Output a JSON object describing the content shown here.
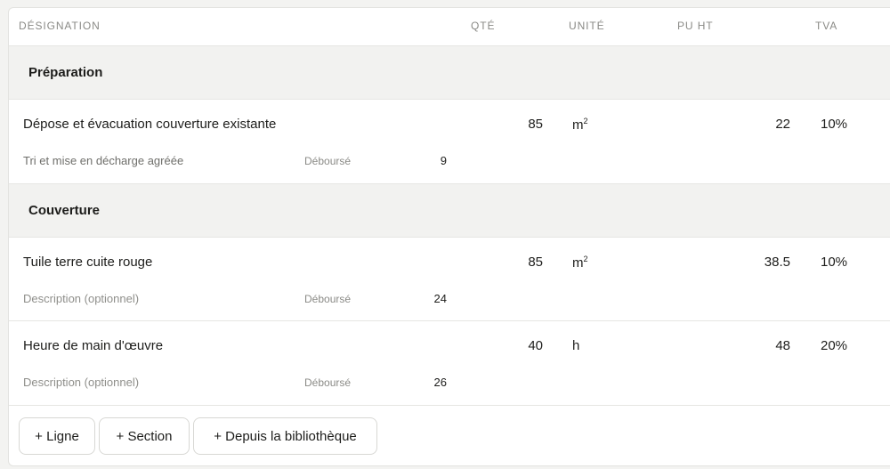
{
  "header": {
    "designation": "DÉSIGNATION",
    "qty": "QTÉ",
    "unit": "UNITÉ",
    "pu_ht": "PU HT",
    "tva": "TVA"
  },
  "sections": [
    {
      "title": "Préparation",
      "lines": [
        {
          "designation": "Dépose et évacuation couverture existante",
          "description": "Tri et mise en décharge agréée",
          "debourse_label": "Déboursé",
          "debourse": "9",
          "qty": "85",
          "unit": "m",
          "unit_sup": "2",
          "pu_ht": "22",
          "tva": "10%"
        }
      ]
    },
    {
      "title": "Couverture",
      "lines": [
        {
          "designation": "Tuile terre cuite rouge",
          "description_placeholder": "Description (optionnel)",
          "debourse_label": "Déboursé",
          "debourse": "24",
          "qty": "85",
          "unit": "m",
          "unit_sup": "2",
          "pu_ht": "38.5",
          "tva": "10%"
        },
        {
          "designation": "Heure de main d'œuvre",
          "description_placeholder": "Description (optionnel)",
          "debourse_label": "Déboursé",
          "debourse": "26",
          "qty": "40",
          "unit": "h",
          "pu_ht": "48",
          "tva": "20%"
        }
      ]
    }
  ],
  "footer": {
    "add_line": "+ Ligne",
    "add_section": "+ Section",
    "from_library": "+ Depuis la bibliothèque"
  }
}
